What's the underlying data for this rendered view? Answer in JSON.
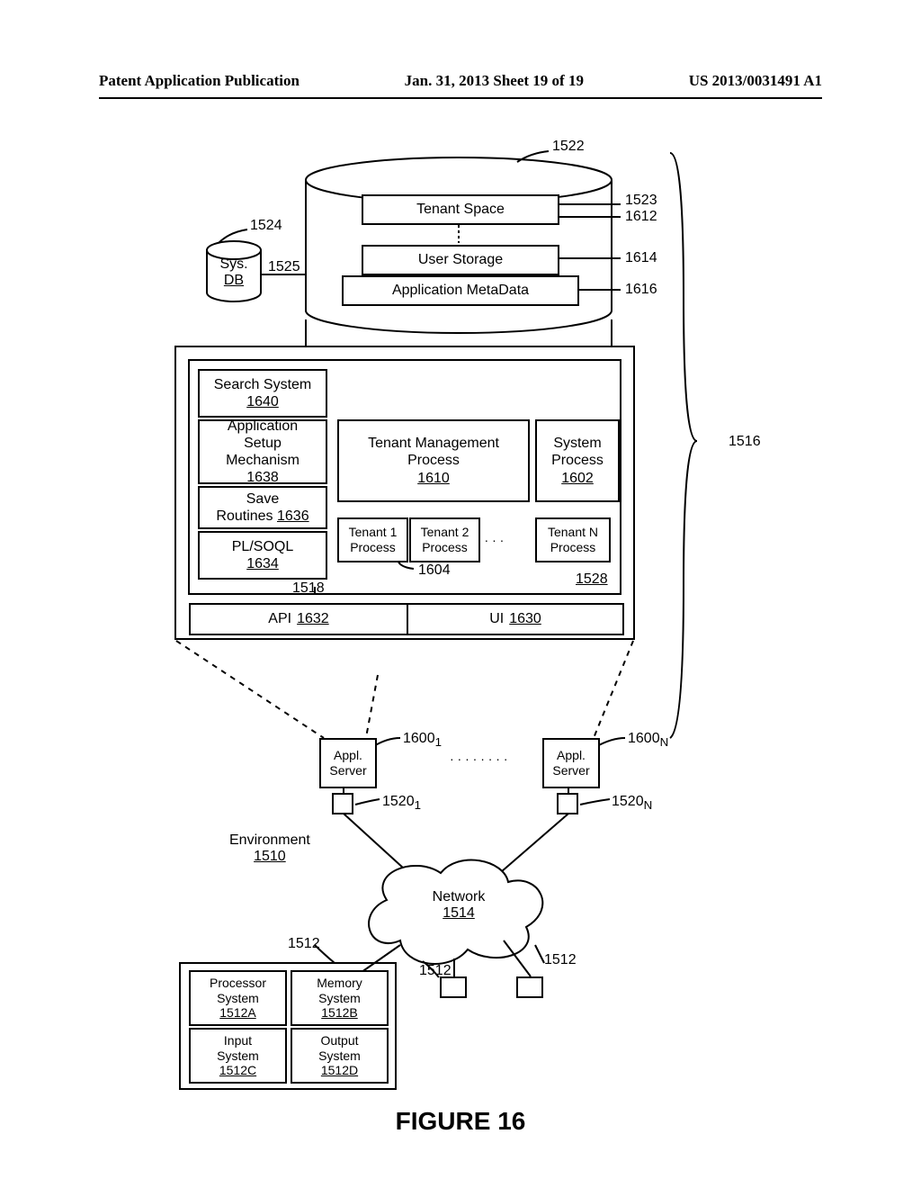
{
  "header": {
    "left": "Patent Application Publication",
    "center": "Jan. 31, 2013  Sheet 19 of 19",
    "right": "US 2013/0031491 A1"
  },
  "figure_caption": "FIGURE 16",
  "db_cylinder": {
    "sys_db": "Sys.\nDB",
    "tenant_space": "Tenant Space",
    "user_storage": "User Storage",
    "app_metadata": "Application MetaData"
  },
  "refs": {
    "r1522": "1522",
    "r1523": "1523",
    "r1524": "1524",
    "r1525": "1525",
    "r1612": "1612",
    "r1614": "1614",
    "r1616": "1616",
    "r1516": "1516",
    "r1518": "1518",
    "r1528": "1528",
    "r1604": "1604",
    "r16001": "1600",
    "r16001_sub": "1",
    "r1600N": "1600",
    "r1600N_sub": "N",
    "r15201": "1520",
    "r15201_sub": "1",
    "r1520N": "1520",
    "r1520N_sub": "N",
    "r1512a": "1512",
    "r1512b": "1512",
    "r1512c": "1512"
  },
  "server_block": {
    "search_system": "Search System",
    "search_system_num": "1640",
    "app_setup": "Application\nSetup\nMechanism",
    "app_setup_num": "1638",
    "save_routines": "Save\nRoutines",
    "save_routines_num": "1636",
    "plsoql": "PL/SOQL",
    "plsoql_num": "1634",
    "tmp": "Tenant Management\nProcess",
    "tmp_num": "1610",
    "sys_process": "System\nProcess",
    "sys_process_num": "1602",
    "t1": "Tenant 1\nProcess",
    "t2": "Tenant 2\nProcess",
    "tn": "Tenant N\nProcess",
    "api": "API",
    "api_num": "1632",
    "ui": "UI",
    "ui_num": "1630"
  },
  "lower": {
    "appl_server": "Appl.\nServer",
    "environment": "Environment",
    "environment_num": "1510",
    "network": "Network",
    "network_num": "1514",
    "proc": "Processor\nSystem",
    "proc_num": "1512A",
    "mem": "Memory\nSystem",
    "mem_num": "1512B",
    "input": "Input\nSystem",
    "input_num": "1512C",
    "output": "Output\nSystem",
    "output_num": "1512D"
  }
}
